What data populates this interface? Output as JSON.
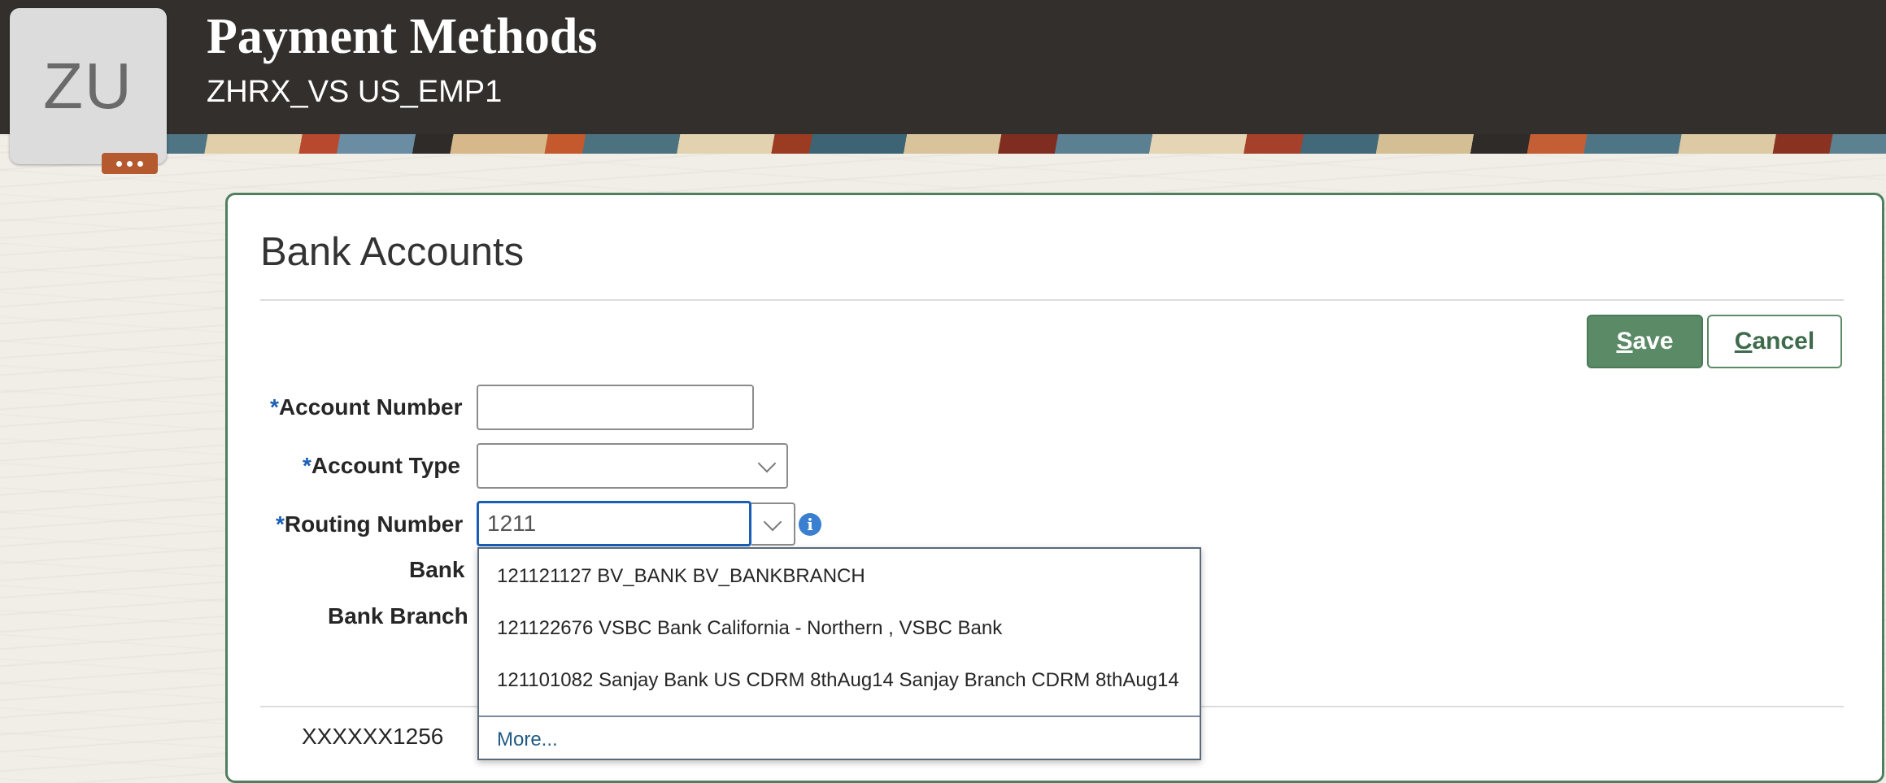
{
  "header": {
    "title": "Payment Methods",
    "subtitle": "ZHRX_VS US_EMP1",
    "avatar_initials": "ZU",
    "avatar_menu_icon": "ellipsis-icon"
  },
  "section": {
    "title": "Bank Accounts"
  },
  "actions": {
    "save_prefix": "S",
    "save_rest": "ave",
    "cancel_prefix": "C",
    "cancel_rest": "ancel"
  },
  "form": {
    "required_marker": "*",
    "account_number_label": "Account Number",
    "account_number_value": "",
    "account_type_label": "Account Type",
    "account_type_value": "",
    "routing_number_label": "Routing Number",
    "routing_number_value": "1211",
    "bank_label": "Bank",
    "bank_branch_label": "Bank Branch"
  },
  "routing_dropdown": {
    "options": [
      "121121127 BV_BANK BV_BANKBRANCH",
      "121122676 VSBC Bank California - Northern , VSBC Bank",
      "121101082 Sanjay Bank US CDRM 8thAug14 Sanjay Branch CDRM 8thAug14"
    ],
    "more_link": "More..."
  },
  "accounts": {
    "masked_number": "XXXXXX1256"
  },
  "colors": {
    "header_bg": "#322f2c",
    "accent_green": "#5a8a66",
    "focus_blue": "#1a5fb4",
    "link_blue": "#1f5a85"
  }
}
